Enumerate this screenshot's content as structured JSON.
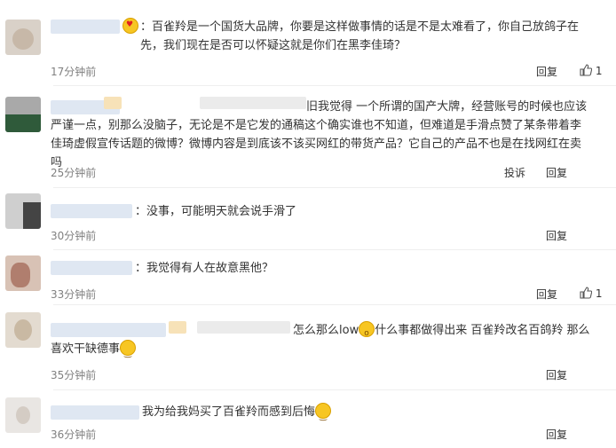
{
  "comments": [
    {
      "text": "：百雀羚是一个国货大品牌，你要是这样做事情的话是不是太难看了，你自己放鸽子在先，我们现在是否可以怀疑这就是你们在黑李佳琦？",
      "time": "17分钟前",
      "reply": "回复",
      "likes": "1"
    },
    {
      "text": "旧我觉得 一个所谓的国产大牌，经营账号的时候也应该严谨一点，别那么没脑子，无论是不是它发的通稿这个确实谁也不知道，但难道是手滑点赞了某条带着李佳琦虚假宣传话题的微博？微博内容是到底该不该买网红的带货产品？它自己的产品不也是在找网红在卖吗",
      "time": "25分钟前",
      "report": "投诉",
      "reply": "回复"
    },
    {
      "text": "：没事，可能明天就会说手滑了",
      "time": "30分钟前",
      "reply": "回复"
    },
    {
      "text": "：我觉得有人在故意黑他？",
      "time": "33分钟前",
      "reply": "回复",
      "likes": "1"
    },
    {
      "text_a": "怎么那么low",
      "text_b": "什么事都做得出来 百雀羚改名百鸽羚 那么喜欢干缺德事",
      "time": "35分钟前",
      "reply": "回复"
    },
    {
      "text": "我为给我妈买了百雀羚而感到后悔",
      "time": "36分钟前",
      "reply": "回复"
    }
  ],
  "icons": {
    "emoji_heart": "heart-eyes-emoji-icon",
    "emoji_smile": "smile-emoji-icon",
    "emoji_wow": "surprised-emoji-icon",
    "thumb": "thumbs-up-icon"
  },
  "colors": {
    "time": "#808080",
    "divider": "#efefef"
  }
}
